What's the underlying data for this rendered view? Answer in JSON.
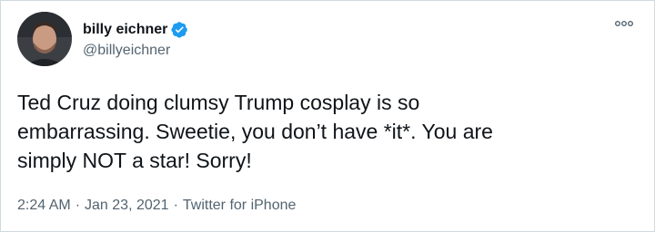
{
  "author": {
    "display_name": "billy eichner",
    "handle": "@billyeichner",
    "verified": true
  },
  "tweet": {
    "lines": [
      "Ted Cruz doing clumsy Trump cosplay is so",
      "embarrassing. Sweetie, you don’t have *it*. You are",
      "simply NOT a star! Sorry!"
    ]
  },
  "meta": {
    "time": "2:24 AM",
    "separator": "·",
    "date": "Jan 23, 2021",
    "source": "Twitter for iPhone"
  },
  "colors": {
    "verified_badge": "#1d9bf0",
    "secondary_text": "#536471",
    "primary_text": "#0f1419"
  }
}
